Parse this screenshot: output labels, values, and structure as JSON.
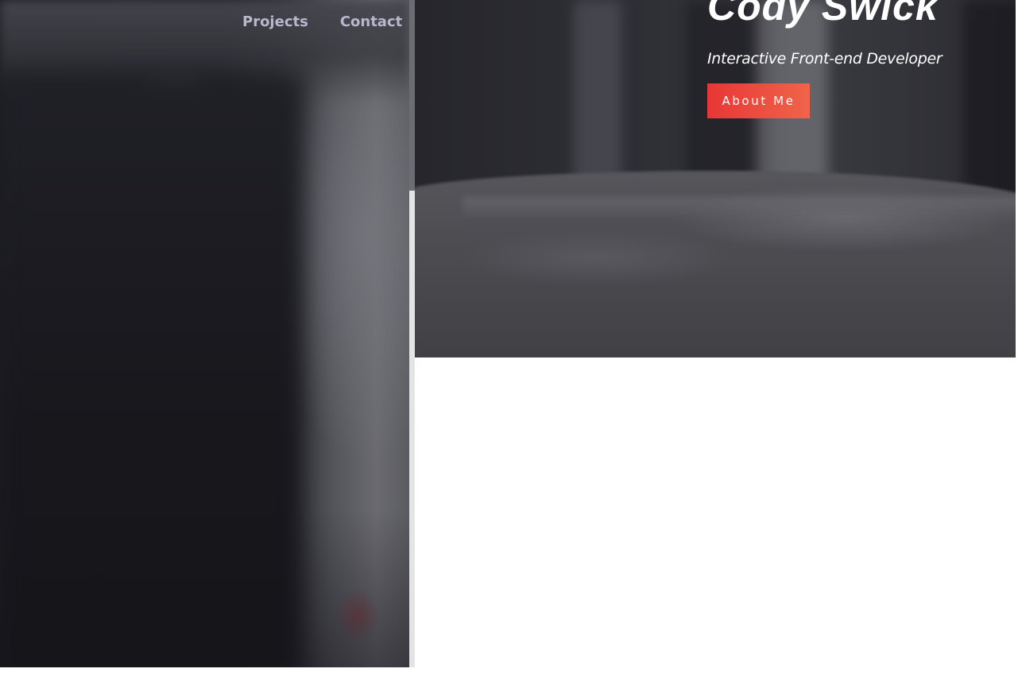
{
  "nav": {
    "items": [
      {
        "label": "Projects"
      },
      {
        "label": "Contact"
      }
    ]
  },
  "hero": {
    "name": "Cody Swick",
    "tagline": "Interactive Front-end Developer",
    "cta_label": "About Me"
  },
  "colors": {
    "nav_text": "#b7b7cd",
    "button_start": "#e83636",
    "button_end": "#f0644a",
    "hero_text": "#ffffff",
    "page_background": "#ffffff"
  }
}
